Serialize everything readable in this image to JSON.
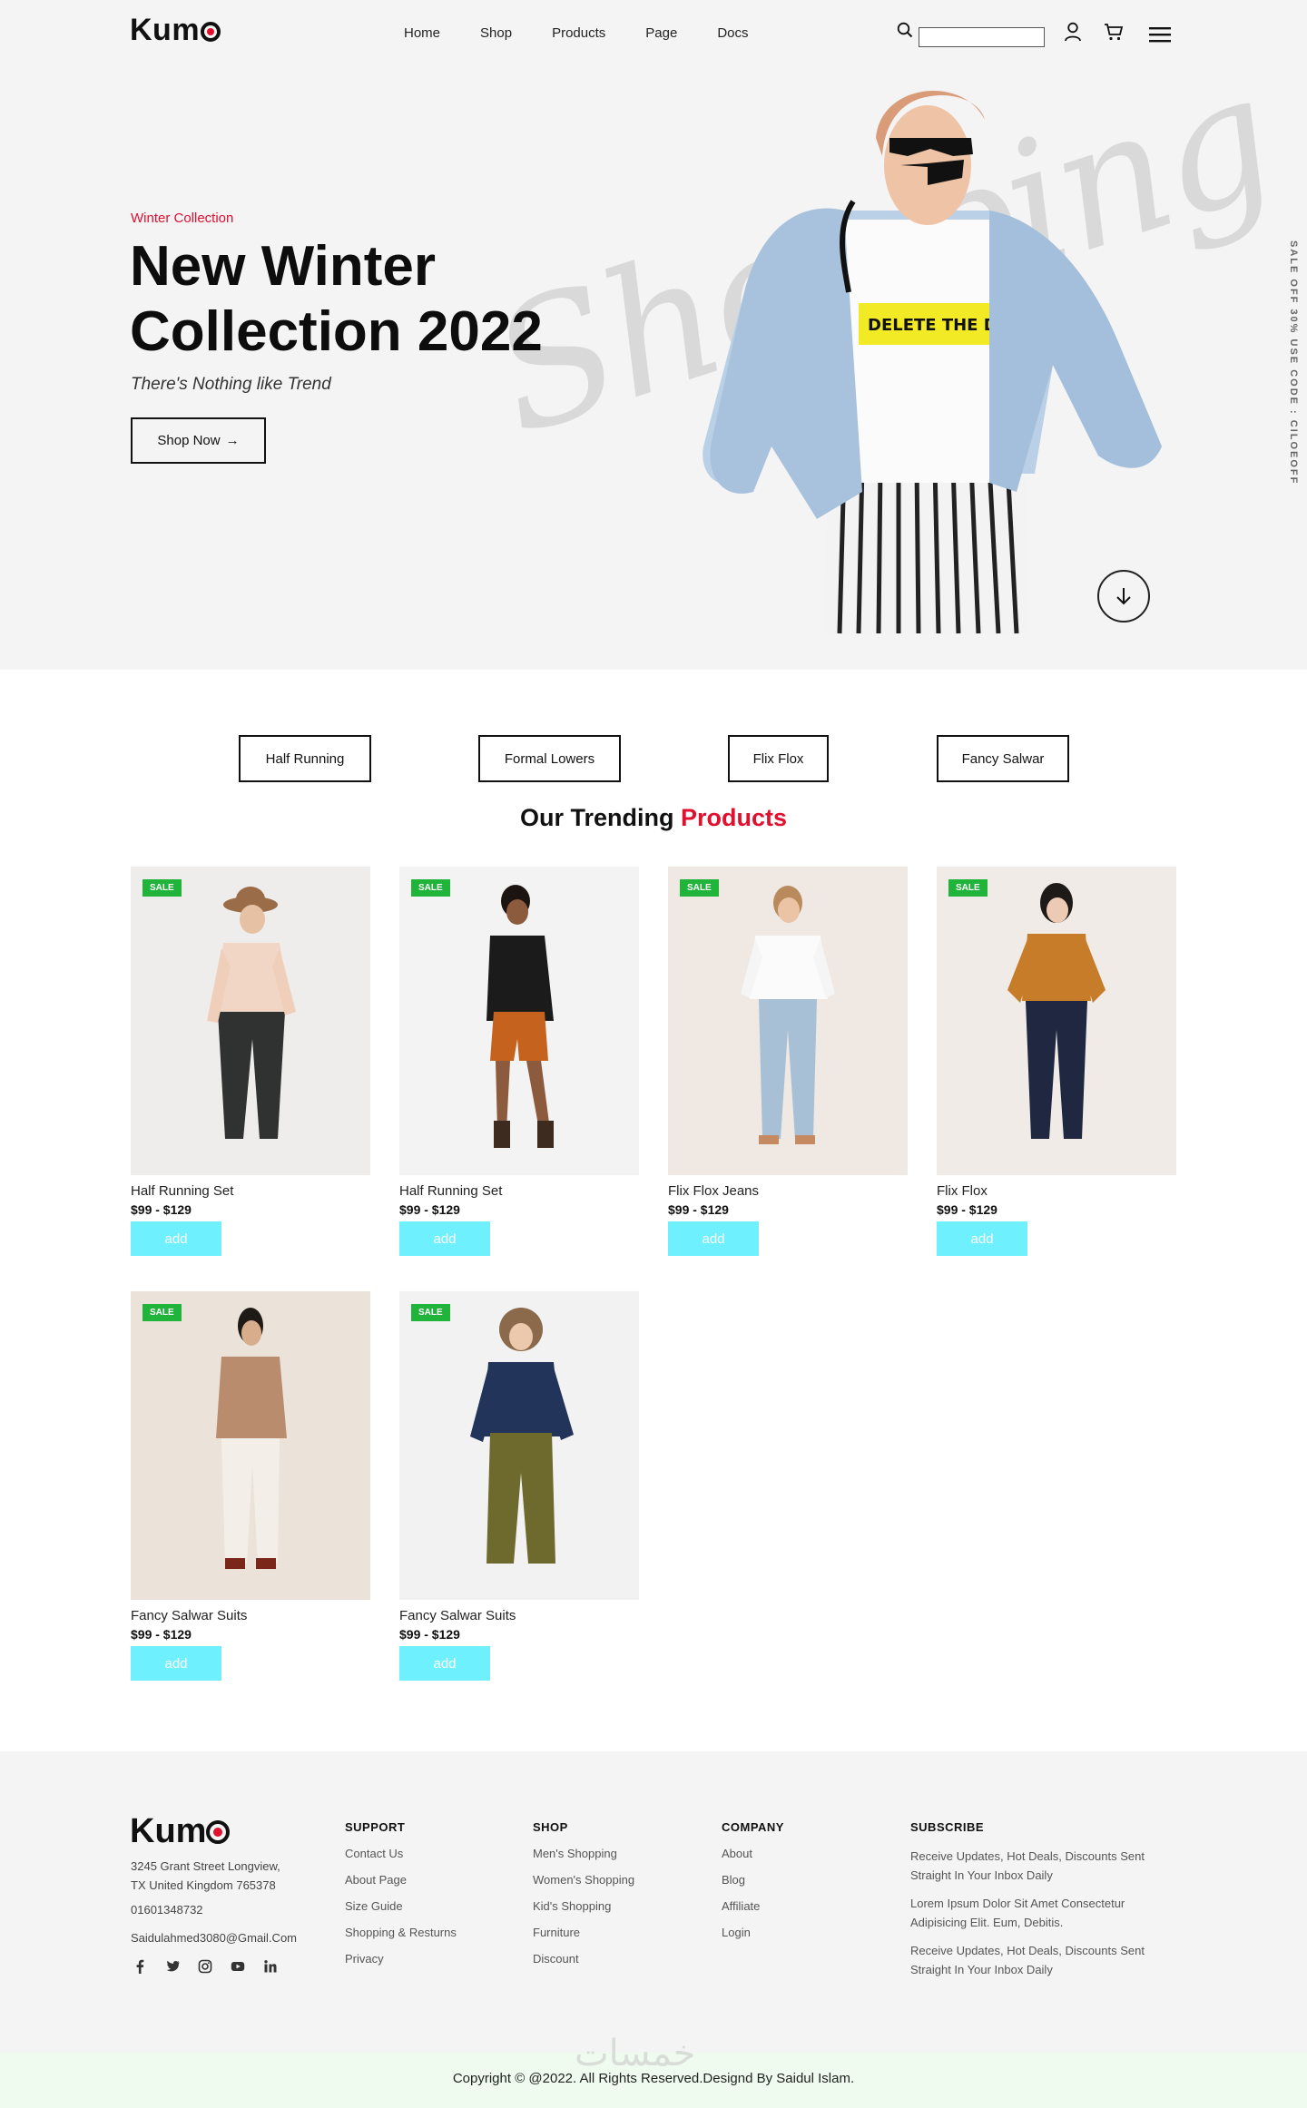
{
  "header": {
    "logo_text": "Kum",
    "nav": [
      "Home",
      "Shop",
      "Products",
      "Page",
      "Docs"
    ],
    "search_placeholder": ""
  },
  "hero": {
    "eyebrow": "Winter Collection",
    "title": "New Winter Collection 2022",
    "tagline": "There's Nothing like Trend",
    "button_label": "Shop Now",
    "background_script": "Shopping",
    "side_promo": "SALE OFF 30% USE CODE : CILOEOFF"
  },
  "categories": [
    "Half Running",
    "Formal Lowers",
    "Flix Flox",
    "Fancy Salwar"
  ],
  "trending": {
    "title_main": "Our Trending",
    "title_accent": "Products",
    "add_label": "add",
    "sale_label": "SALE",
    "products": [
      {
        "name": "Half Running Set",
        "price": "$99 - $129"
      },
      {
        "name": "Half Running Set",
        "price": "$99 - $129"
      },
      {
        "name": "Flix Flox Jeans",
        "price": "$99 - $129"
      },
      {
        "name": "Flix Flox",
        "price": "$99 - $129"
      },
      {
        "name": "Fancy Salwar Suits",
        "price": "$99 - $129"
      },
      {
        "name": "Fancy Salwar Suits",
        "price": "$99 - $129"
      }
    ]
  },
  "footer": {
    "logo_text": "Kum",
    "address_line1": "3245 Grant Street Longview,",
    "address_line2": "TX United Kingdom 765378",
    "phone": "01601348732",
    "email": "Saidulahmed3080@Gmail.Com",
    "support": {
      "title": "SUPPORT",
      "links": [
        "Contact Us",
        "About Page",
        "Size Guide",
        "Shopping & Resturns",
        "Privacy"
      ]
    },
    "shop": {
      "title": "SHOP",
      "links": [
        "Men's Shopping",
        "Women's Shopping",
        "Kid's Shopping",
        "Furniture",
        "Discount"
      ]
    },
    "company": {
      "title": "COMPANY",
      "links": [
        "About",
        "Blog",
        "Affiliate",
        "Login"
      ]
    },
    "subscribe": {
      "title": "SUBSCRIBE",
      "items": [
        "Receive Updates, Hot Deals, Discounts Sent Straight In Your Inbox Daily",
        "Lorem Ipsum Dolor Sit Amet Consectetur Adipisicing Elit. Eum, Debitis.",
        "Receive Updates, Hot Deals, Discounts Sent Straight In Your Inbox Daily"
      ]
    },
    "copyright": "Copyright © @2022. All Rights Reserved.Designd By Saidul Islam.",
    "watermark": "خمسات"
  },
  "colors": {
    "accent": "#e0102e",
    "sale": "#21b43b",
    "add_button": "#6ff0ff",
    "hero_bg": "#f4f4f5"
  }
}
